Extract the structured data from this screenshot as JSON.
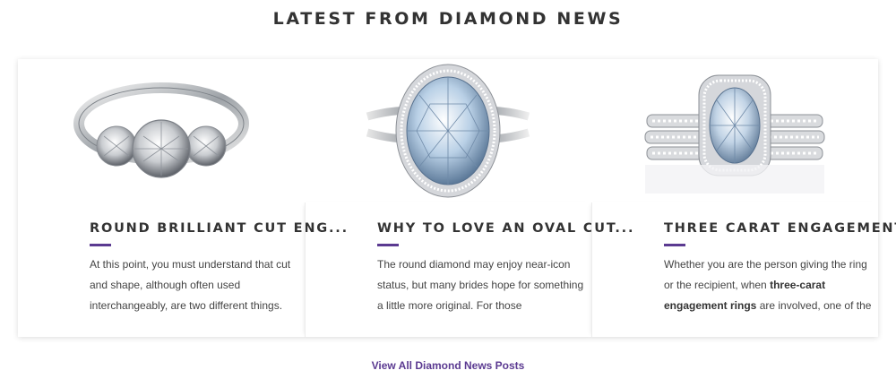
{
  "section": {
    "title": "LATEST FROM DIAMOND NEWS"
  },
  "posts": [
    {
      "title": "ROUND BRILLIANT CUT ENG...",
      "excerpt": "At this point, you must understand that cut and shape, although often used interchangeably, are two different things.",
      "image_icon": "three-stone-ring-image"
    },
    {
      "title": "WHY TO LOVE AN OVAL CUT...",
      "excerpt": "The round diamond may enjoy near-icon status, but many brides hope for something a little more original. For those",
      "image_icon": "oval-halo-ring-image"
    },
    {
      "title": "THREE CARAT ENGAGEMENT...",
      "excerpt_pre": "Whether you are the person giving the ring or the recipient, when ",
      "excerpt_bold": "three-carat engagement rings",
      "excerpt_post": " are involved, one of the",
      "image_icon": "halo-ring-stack-image"
    }
  ],
  "footer": {
    "view_all_label": "View All Diamond News Posts"
  },
  "colors": {
    "accent": "#5b3a91",
    "text": "#333333"
  }
}
